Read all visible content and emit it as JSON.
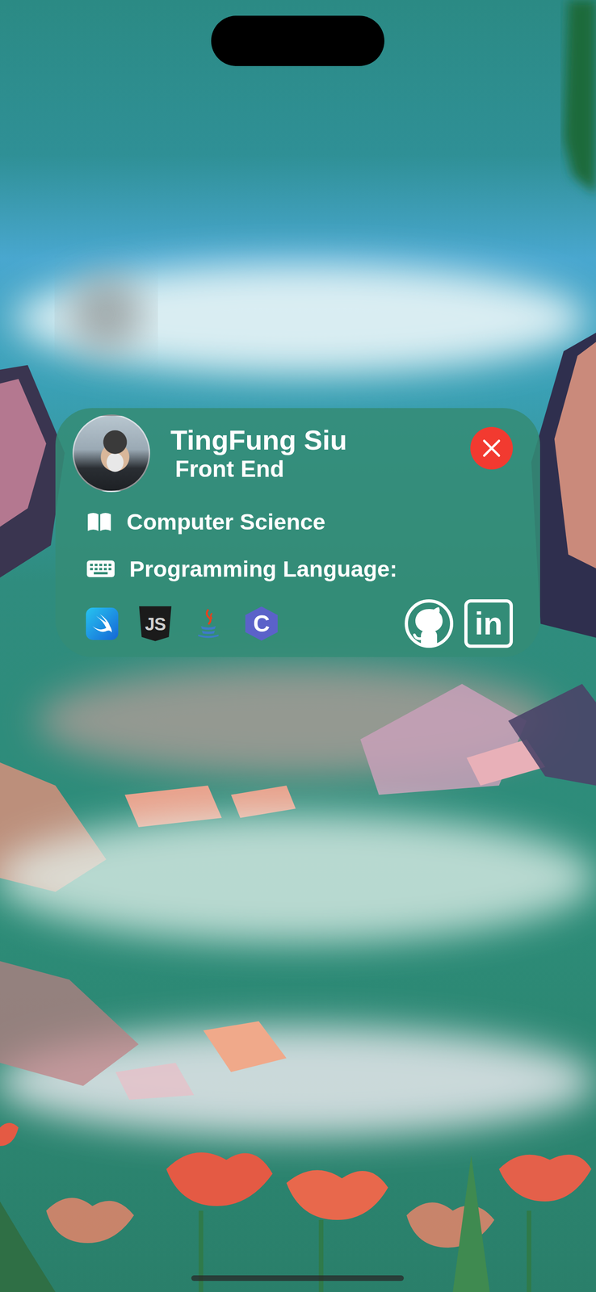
{
  "profile": {
    "name": "TingFung Siu",
    "role": "Front End",
    "major": "Computer Science",
    "languages_label": "Programming Language:"
  },
  "languages": [
    {
      "kind": "swift"
    },
    {
      "kind": "javascript",
      "text": "JS"
    },
    {
      "kind": "java"
    },
    {
      "kind": "c",
      "text": "C"
    }
  ],
  "links": [
    {
      "kind": "github"
    },
    {
      "kind": "linkedin",
      "text": "in"
    }
  ]
}
